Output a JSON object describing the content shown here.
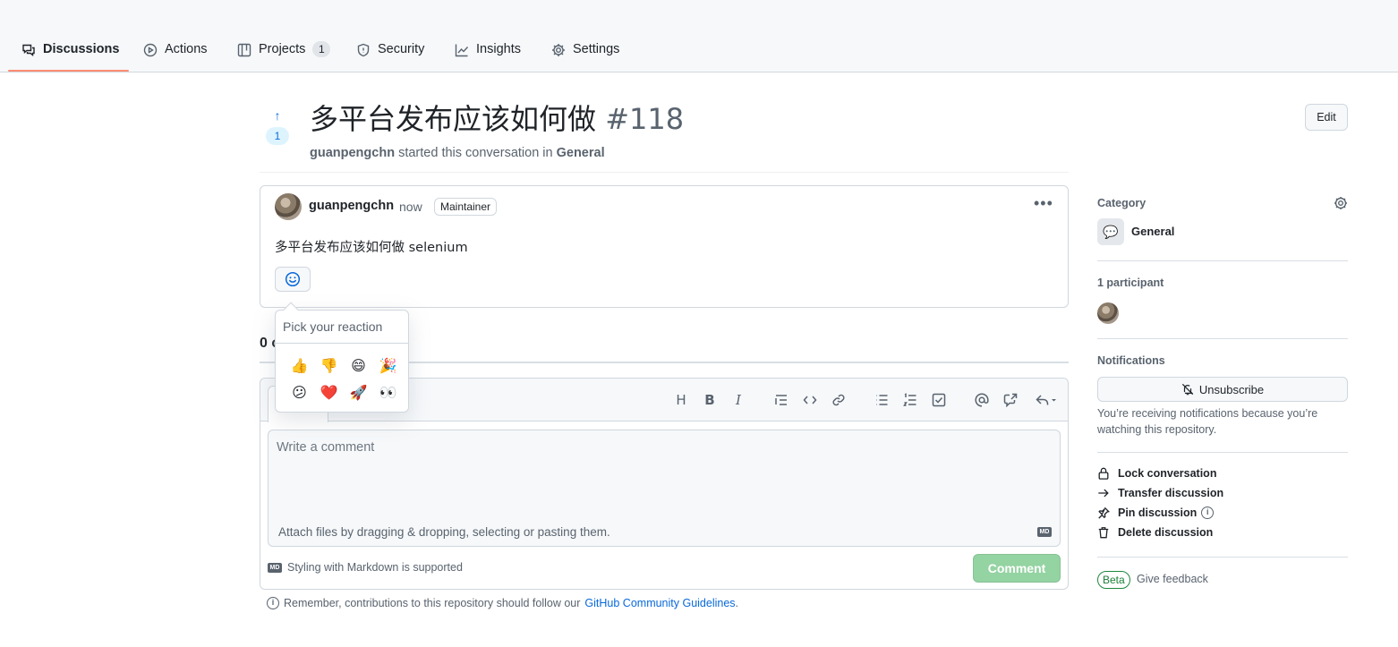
{
  "nav": {
    "tabs": [
      {
        "label": "Discussions",
        "icon": "comment-discussion-icon",
        "active": true
      },
      {
        "label": "Actions",
        "icon": "play-icon"
      },
      {
        "label": "Projects",
        "icon": "table-icon",
        "counter": "1"
      },
      {
        "label": "Security",
        "icon": "shield-icon"
      },
      {
        "label": "Insights",
        "icon": "graph-icon"
      },
      {
        "label": "Settings",
        "icon": "gear-icon"
      }
    ]
  },
  "discussion": {
    "upvote_count": "1",
    "title": "多平台发布应该如何做",
    "number": "#118",
    "author": "guanpengchn",
    "started_text": "started this conversation in",
    "category": "General",
    "edit_label": "Edit"
  },
  "comment": {
    "author": "guanpengchn",
    "time": "now",
    "badge": "Maintainer",
    "body": "多平台发布应该如何做 selenium"
  },
  "reactions": {
    "title": "Pick your reaction",
    "emojis": [
      {
        "name": "thumbs-up",
        "glyph": "👍"
      },
      {
        "name": "thumbs-down",
        "glyph": "👎"
      },
      {
        "name": "laugh",
        "glyph": "😄"
      },
      {
        "name": "hooray",
        "glyph": "🎉"
      },
      {
        "name": "confused",
        "glyph": "😕"
      },
      {
        "name": "heart",
        "glyph": "❤️"
      },
      {
        "name": "rocket",
        "glyph": "🚀"
      },
      {
        "name": "eyes",
        "glyph": "👀"
      }
    ]
  },
  "timeline": {
    "comments_count": "0 c"
  },
  "editor": {
    "placeholder": "Write a comment",
    "attach_text": "Attach files by dragging & dropping, selecting or pasting them.",
    "markdown_hint": "Styling with Markdown is supported",
    "markdown_badge": "MD",
    "submit_label": "Comment",
    "tools": [
      "heading-icon",
      "bold-icon",
      "italic-icon",
      "quote-icon",
      "code-icon",
      "link-icon",
      "unordered-list-icon",
      "ordered-list-icon",
      "tasklist-icon",
      "mention-icon",
      "cross-reference-icon",
      "reply-icon"
    ]
  },
  "guidelines": {
    "prefix": "Remember, contributions to this repository should follow our",
    "link": "GitHub Community Guidelines",
    "suffix": "."
  },
  "sidebar": {
    "category_heading": "Category",
    "category_name": "General",
    "category_emoji": "💬",
    "participants_heading": "1 participant",
    "notifications_heading": "Notifications",
    "unsubscribe_label": "Unsubscribe",
    "notif_text": "You’re receiving notifications because you’re watching this repository.",
    "actions": [
      {
        "label": "Lock conversation",
        "icon": "lock-icon"
      },
      {
        "label": "Transfer discussion",
        "icon": "arrow-right-icon"
      },
      {
        "label": "Pin discussion",
        "icon": "pin-icon"
      },
      {
        "label": "Delete discussion",
        "icon": "trash-icon"
      }
    ],
    "beta_label": "Beta",
    "feedback_label": "Give feedback"
  },
  "colors": {
    "accent": "#0969da",
    "tab_underline": "#fd8c73",
    "comment_button": "#94d3a2"
  }
}
